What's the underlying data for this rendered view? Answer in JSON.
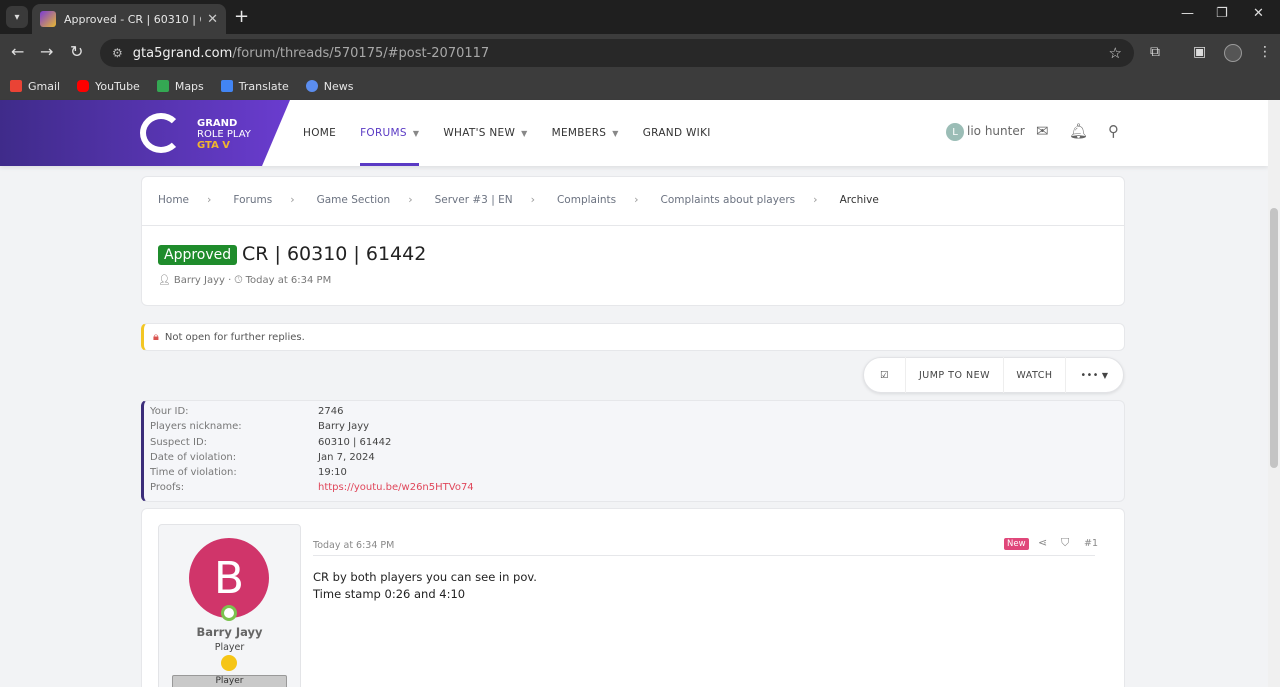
{
  "browser": {
    "tab_title": "Approved - CR | 60310 | 61442 |",
    "url_host": "gta5grand.com",
    "url_path": "/forum/threads/570175/#post-2070117",
    "bookmarks": [
      "Gmail",
      "YouTube",
      "Maps",
      "Translate",
      "News"
    ]
  },
  "site": {
    "logo_line1": "GRAND",
    "logo_line2": "ROLE PLAY",
    "logo_line3": "GTA V",
    "nav": [
      "HOME",
      "FORUMS",
      "WHAT'S NEW",
      "MEMBERS",
      "GRAND WIKI"
    ],
    "user_initial": "L",
    "user_name": "lio hunter"
  },
  "breadcrumb": [
    "Home",
    "Forums",
    "Game Section",
    "Server #3 | EN",
    "Complaints",
    "Complaints about players",
    "Archive"
  ],
  "thread": {
    "prefix": "Approved",
    "title": "CR | 60310 | 61442",
    "author": "Barry Jayy",
    "date": "Today at 6:34 PM",
    "notice": "Not open for further replies."
  },
  "actions": {
    "jump": "JUMP TO NEW",
    "watch": "WATCH",
    "more": "•••"
  },
  "fields": [
    {
      "label": "Your ID:",
      "value": "2746"
    },
    {
      "label": "Players nickname:",
      "value": "Barry Jayy"
    },
    {
      "label": "Suspect ID:",
      "value": "60310 | 61442"
    },
    {
      "label": "Date of violation:",
      "value": "Jan 7, 2024"
    },
    {
      "label": "Time of violation:",
      "value": "19:10"
    },
    {
      "label": "Proofs:",
      "value": "https://youtu.be/w26n5HTVo74"
    }
  ],
  "post": {
    "avatar_letter": "B",
    "username": "Barry Jayy",
    "role": "Player",
    "role_bar": "Player",
    "date": "Today at 6:34 PM",
    "badge": "New",
    "number": "#1",
    "line1": "CR by both players you can see in pov.",
    "line2": "Time stamp 0:26 and 4:10"
  },
  "colors": {
    "accent": "#5a3ac4",
    "approved": "#1f8c2c",
    "link": "#e0475b",
    "avatar": "#d0356a"
  }
}
